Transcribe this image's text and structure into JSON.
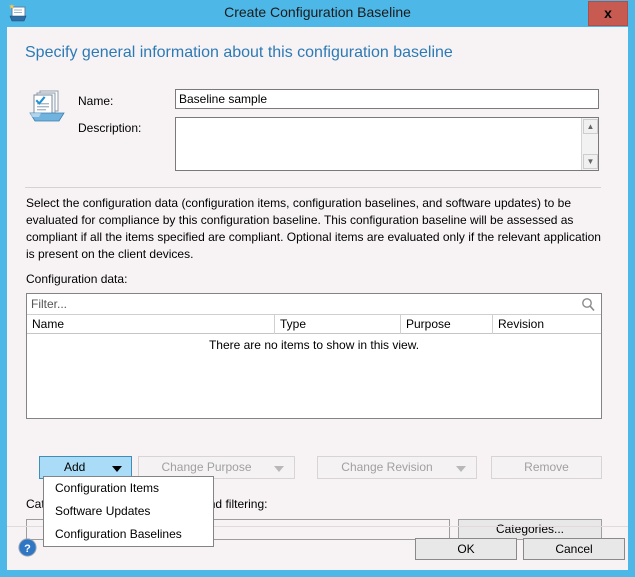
{
  "window": {
    "title": "Create Configuration Baseline",
    "title_icon": "baseline-document-icon",
    "close_label": "x",
    "frame_color": "#4db8e8",
    "client_bg": "#f7f3f4"
  },
  "page": {
    "heading": "Specify general information about this configuration baseline",
    "heading_color": "#2c7ab5",
    "form_icon": "configuration-baseline-icon"
  },
  "form": {
    "name_label": "Name:",
    "name_value": "Baseline sample",
    "name_placeholder": "",
    "description_label": "Description:",
    "description_value": "",
    "description_placeholder": ""
  },
  "paragraph": "Select the configuration data (configuration items, configuration baselines, and software updates) to be evaluated for compliance by this configuration baseline. This configuration baseline will be assessed as compliant if all the items specified are compliant. Optional items are evaluated only if the relevant application is present on  the client devices.",
  "config_data": {
    "label": "Configuration data:",
    "filter_placeholder": "Filter...",
    "filter_value": "",
    "search_icon": "search-icon",
    "columns": [
      "Name",
      "Type",
      "Purpose",
      "Revision"
    ],
    "rows": [],
    "empty_message": "There are no items to show in this view."
  },
  "actions": {
    "add": {
      "label": "Add",
      "enabled": true,
      "has_caret": true,
      "highlight_color": "#aadcf7"
    },
    "change_purpose": {
      "label": "Change Purpose",
      "enabled": false,
      "has_caret": true
    },
    "change_revision": {
      "label": "Change Revision",
      "enabled": false,
      "has_caret": true
    },
    "remove": {
      "label": "Remove",
      "enabled": false,
      "has_caret": false
    }
  },
  "add_menu": {
    "open": true,
    "items": [
      {
        "label": "Configuration Items"
      },
      {
        "label": "Software Updates"
      },
      {
        "label": "Configuration Baselines"
      }
    ]
  },
  "categories": {
    "label": "Categories to improve searching and filtering:",
    "value": "",
    "button_label": "Categories..."
  },
  "footer": {
    "help_icon": "help-icon",
    "ok_label": "OK",
    "cancel_label": "Cancel"
  }
}
